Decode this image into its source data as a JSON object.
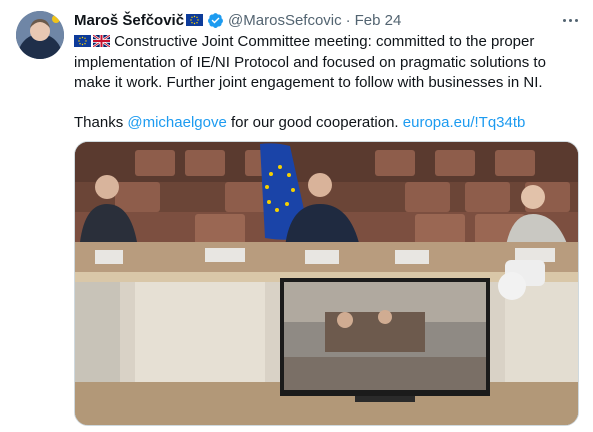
{
  "tweet": {
    "display_name": "Maroš Šefčovič",
    "handle": "@MarosSefcovic",
    "separator": "·",
    "date": "Feb 24",
    "text_line1": "Constructive Joint Committee meeting: committed to the proper",
    "text_line2": "implementation of IE/NI Protocol and focused on pragmatic solutions to",
    "text_line3": "make it work. Further joint engagement to follow with businesses in NI.",
    "thanks_prefix": "Thanks ",
    "mention": "@michaelgove",
    "thanks_middle": " for our good cooperation. ",
    "link": "europa.eu/!Tq34tb",
    "flags": [
      "eu-flag-icon",
      "uk-flag-icon"
    ]
  },
  "colors": {
    "link": "#1d9bf0",
    "verified": "#1d9bf0",
    "secondary_text": "#536471"
  }
}
